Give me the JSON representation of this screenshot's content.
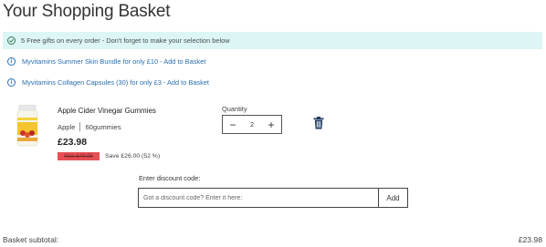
{
  "page": {
    "title": "Your Shopping Basket"
  },
  "banner": {
    "text": "5 Free gifts on every order - Don't forget to make your selection below",
    "icon": "check-circle-icon",
    "bg_color": "#dcf6f5"
  },
  "offers": [
    {
      "label": "Myvitamins Summer Skin Bundle for only £10 - Add to Basket",
      "icon": "info-icon"
    },
    {
      "label": "Myvitamins Collagen Capsules (30) for only £3 - Add to Basket",
      "icon": "info-icon"
    }
  ],
  "item": {
    "name": "Apple Cider Vinegar Gummies",
    "flavour": "Apple",
    "size": "60gummies",
    "price": "£23.98",
    "was_price": "Was £49.95",
    "save_text": "Save £26.00 (52 %)",
    "quantity_label": "Quantity",
    "quantity": "2",
    "minus_label": "−",
    "plus_label": "+",
    "remove_icon": "trash-icon"
  },
  "discount": {
    "label": "Enter discount code:",
    "placeholder": "Got a discount code? Enter it here:",
    "button_label": "Add"
  },
  "summary": {
    "subtotal_label": "Basket subtotal:",
    "subtotal_value": "£23.98"
  },
  "colors": {
    "accent_link": "#2a6fb0",
    "was_badge": "#e84f55"
  }
}
